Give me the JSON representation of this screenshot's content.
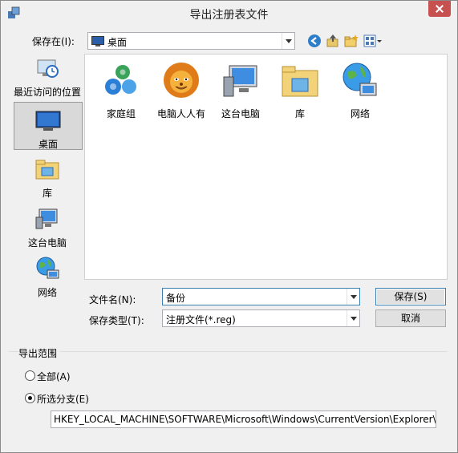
{
  "window": {
    "title": "导出注册表文件"
  },
  "save_in": {
    "label": "保存在(I):",
    "value": "桌面"
  },
  "places": [
    {
      "label": "最近访问的位置",
      "icon": "recent-places-icon"
    },
    {
      "label": "桌面",
      "icon": "desktop-icon"
    },
    {
      "label": "库",
      "icon": "library-icon"
    },
    {
      "label": "这台电脑",
      "icon": "computer-icon"
    },
    {
      "label": "网络",
      "icon": "network-icon"
    }
  ],
  "files": [
    {
      "label": "家庭组",
      "icon": "homegroup-icon"
    },
    {
      "label": "电脑人人有",
      "icon": "lion-icon"
    },
    {
      "label": "这台电脑",
      "icon": "computer-icon"
    },
    {
      "label": "库",
      "icon": "library-icon"
    },
    {
      "label": "网络",
      "icon": "network-icon"
    }
  ],
  "filename": {
    "label": "文件名(N):",
    "value": "备份"
  },
  "filetype": {
    "label": "保存类型(T):",
    "value": "注册文件(*.reg)"
  },
  "buttons": {
    "save": "保存(S)",
    "cancel": "取消"
  },
  "export_range": {
    "label": "导出范围",
    "all": "全部(A)",
    "selected_branch": "所选分支(E)",
    "path": "HKEY_LOCAL_MACHINE\\SOFTWARE\\Microsoft\\Windows\\CurrentVersion\\Explorer\\"
  },
  "colors": {
    "accent": "#3c7fb1",
    "close": "#c75050",
    "panel": "#f0f0f0"
  }
}
